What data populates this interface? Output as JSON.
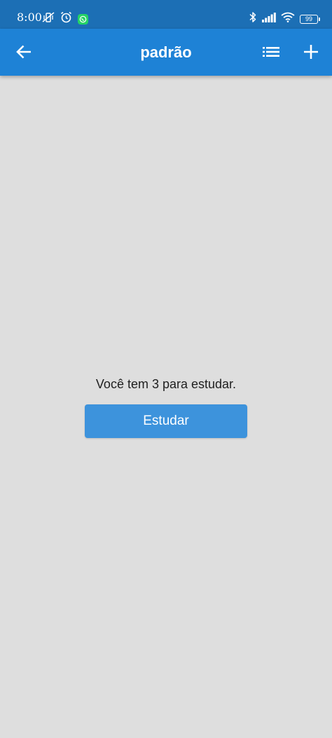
{
  "status_bar": {
    "time": "8:00",
    "battery_level": "99",
    "icons": [
      "vibrate-off-icon",
      "alarm-icon",
      "whatsapp-icon",
      "bluetooth-icon",
      "signal-icon",
      "wifi-icon",
      "battery-icon"
    ]
  },
  "app_bar": {
    "title": "padrão",
    "back_icon": "arrow-left-icon",
    "list_icon": "list-icon",
    "add_icon": "plus-icon"
  },
  "content": {
    "message": "Você tem 3 para estudar.",
    "study_button_label": "Estudar"
  },
  "colors": {
    "status_bar": "#1c6fb5",
    "app_bar": "#1e82d6",
    "button": "#3d93dc",
    "background": "#dedede",
    "text": "#1f1f1f"
  }
}
